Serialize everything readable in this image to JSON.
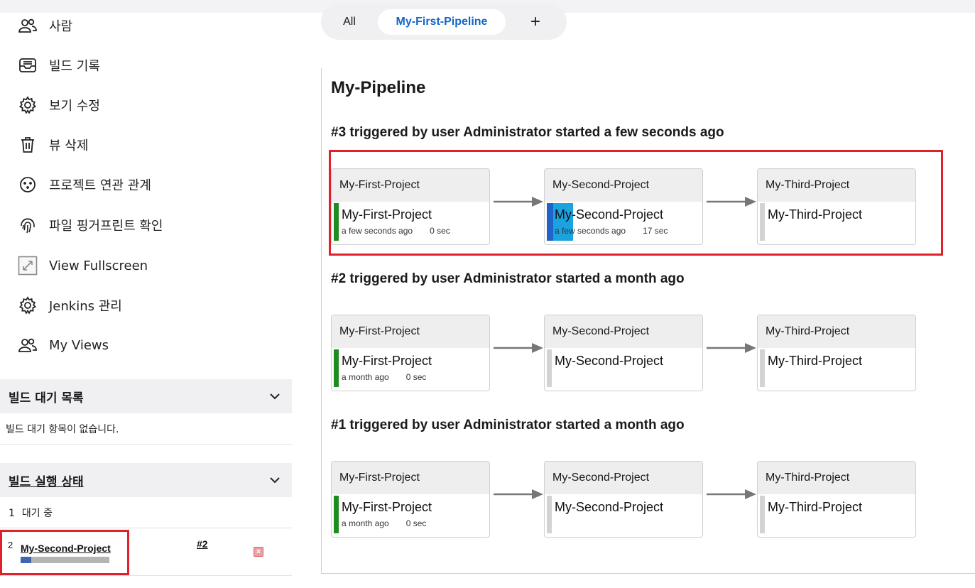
{
  "sidebar": {
    "items": [
      {
        "label": "사람",
        "icon": "people-icon"
      },
      {
        "label": "빌드 기록",
        "icon": "inbox-icon"
      },
      {
        "label": "보기 수정",
        "icon": "gear-icon"
      },
      {
        "label": "뷰 삭제",
        "icon": "trash-icon"
      },
      {
        "label": "프로젝트 연관 관계",
        "icon": "relationship-icon"
      },
      {
        "label": "파일 핑거프린트 확인",
        "icon": "fingerprint-icon"
      },
      {
        "label": "View Fullscreen",
        "icon": "fullscreen-icon"
      },
      {
        "label": "Jenkins 관리",
        "icon": "gear-icon"
      },
      {
        "label": "My Views",
        "icon": "people-icon"
      }
    ],
    "build_queue": {
      "title": "빌드 대기 목록",
      "empty_text": "빌드 대기 항목이 없습니다."
    },
    "executors": {
      "title": "빌드 실행 상태",
      "idle_number": "1",
      "idle_label": "대기 중",
      "busy_number": "2",
      "busy_job": "My-Second-Project",
      "busy_build": "#2",
      "progress": 0.12
    }
  },
  "tabs": [
    {
      "label": "All",
      "active": false
    },
    {
      "label": "My-First-Pipeline",
      "active": true
    },
    {
      "label": "+",
      "active": false
    }
  ],
  "pipeline": {
    "title": "My-Pipeline",
    "runs": [
      {
        "heading": "#3 triggered by user Administrator started a few seconds ago",
        "stages": [
          {
            "header": "My-First-Project",
            "name": "My-First-Project",
            "status": "success",
            "time": "a few seconds ago",
            "duration": "0 sec"
          },
          {
            "header": "My-Second-Project",
            "name": "My-Second-Project",
            "status": "running",
            "time": "a few seconds ago",
            "duration": "17 sec"
          },
          {
            "header": "My-Third-Project",
            "name": "My-Third-Project",
            "status": "pending",
            "time": "",
            "duration": ""
          }
        ]
      },
      {
        "heading": "#2 triggered by user Administrator started a month ago",
        "stages": [
          {
            "header": "My-First-Project",
            "name": "My-First-Project",
            "status": "success",
            "time": "a month ago",
            "duration": "0 sec"
          },
          {
            "header": "My-Second-Project",
            "name": "My-Second-Project",
            "status": "pending",
            "time": "",
            "duration": ""
          },
          {
            "header": "My-Third-Project",
            "name": "My-Third-Project",
            "status": "pending",
            "time": "",
            "duration": ""
          }
        ]
      },
      {
        "heading": "#1 triggered by user Administrator started a month ago",
        "stages": [
          {
            "header": "My-First-Project",
            "name": "My-First-Project",
            "status": "success",
            "time": "a month ago",
            "duration": "0 sec"
          },
          {
            "header": "My-Second-Project",
            "name": "My-Second-Project",
            "status": "pending",
            "time": "",
            "duration": ""
          },
          {
            "header": "My-Third-Project",
            "name": "My-Third-Project",
            "status": "pending",
            "time": "",
            "duration": ""
          }
        ]
      }
    ]
  },
  "colors": {
    "success": "#1e8c1e",
    "running": "#1aa4df",
    "pending": "#d3d3d3",
    "highlight": "#e0202b",
    "tab_active": "#1466c8"
  }
}
